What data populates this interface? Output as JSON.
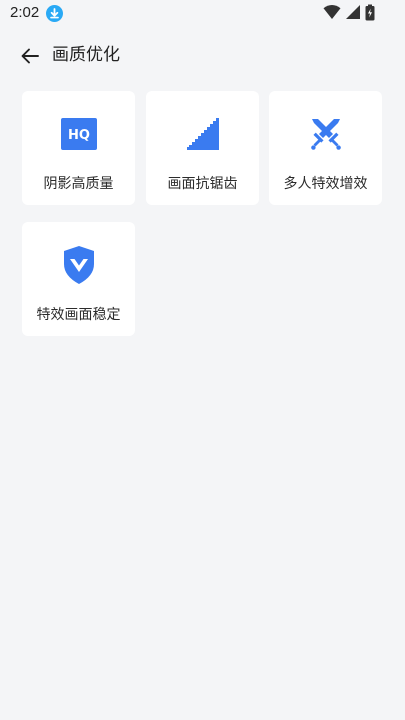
{
  "status_bar": {
    "time": "2:02",
    "icons": [
      "download-icon",
      "wifi-icon",
      "signal-icon",
      "battery-icon"
    ]
  },
  "header": {
    "back_icon": "arrow-left-icon",
    "title": "画质优化"
  },
  "features": [
    {
      "label": "阴影高质量",
      "icon": "hq-icon"
    },
    {
      "label": "画面抗锯齿",
      "icon": "anti-alias-icon"
    },
    {
      "label": "多人特效增效",
      "icon": "crossed-swords-icon"
    },
    {
      "label": "特效画面稳定",
      "icon": "shield-icon"
    }
  ],
  "colors": {
    "background": "#f4f5f7",
    "card": "#ffffff",
    "accent": "#3a7bf0",
    "download_badge": "#29a9f5"
  }
}
